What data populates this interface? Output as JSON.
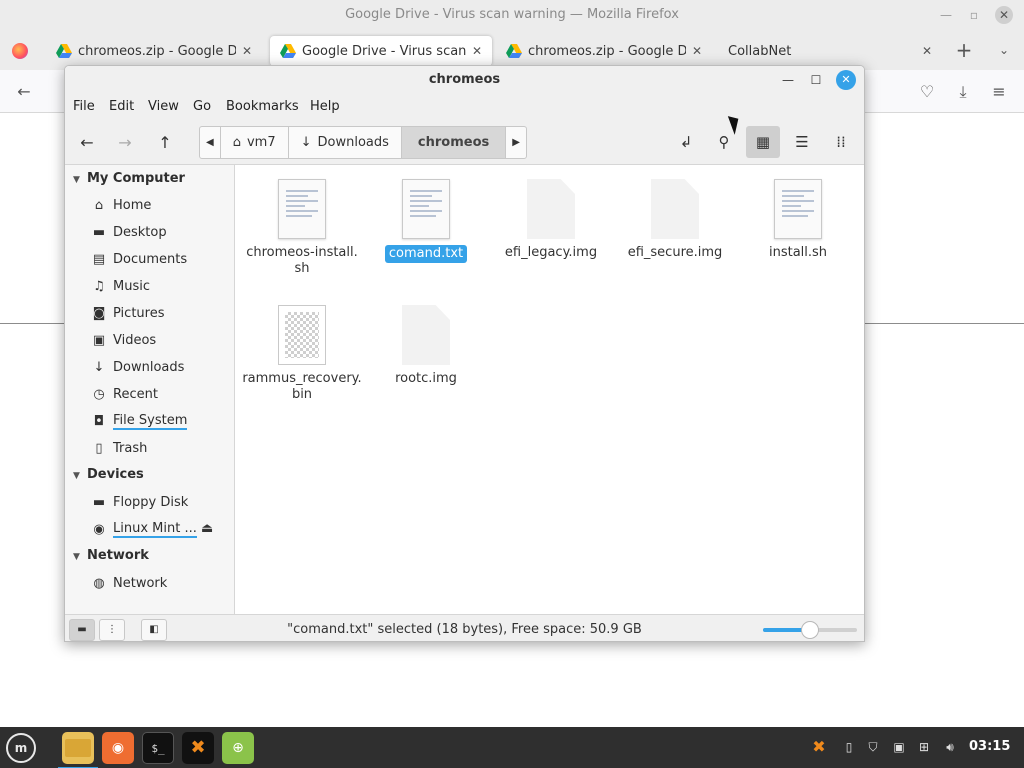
{
  "firefox": {
    "window_title": "Google Drive - Virus scan warning — Mozilla Firefox",
    "tabs": [
      {
        "label": "chromeos.zip - Google Drive",
        "active": false
      },
      {
        "label": "Google Drive - Virus scan wa",
        "active": true
      },
      {
        "label": "chromeos.zip - Google Drive",
        "active": false
      },
      {
        "label": "CollabNet",
        "active": false
      }
    ],
    "icons": [
      "firefox-icon",
      "google-drive-icon",
      "new-tab-icon",
      "list-all-tabs-icon",
      "back-icon",
      "pocket-icon",
      "downloads-icon",
      "hamburger-menu-icon"
    ]
  },
  "file_manager": {
    "title": "chromeos",
    "menu": [
      "File",
      "Edit",
      "View",
      "Go",
      "Bookmarks",
      "Help"
    ],
    "path": [
      {
        "label": "vm7",
        "icon": "home-icon"
      },
      {
        "label": "Downloads",
        "icon": "download-icon"
      },
      {
        "label": "chromeos",
        "icon": "",
        "current": true
      }
    ],
    "sidebar": {
      "my_computer": {
        "heading": "My Computer",
        "items": [
          {
            "label": "Home",
            "icon": "home-icon"
          },
          {
            "label": "Desktop",
            "icon": "desktop-icon"
          },
          {
            "label": "Documents",
            "icon": "documents-icon"
          },
          {
            "label": "Music",
            "icon": "music-icon"
          },
          {
            "label": "Pictures",
            "icon": "pictures-icon"
          },
          {
            "label": "Videos",
            "icon": "videos-icon"
          },
          {
            "label": "Downloads",
            "icon": "download-icon"
          },
          {
            "label": "Recent",
            "icon": "recent-icon"
          },
          {
            "label": "File System",
            "icon": "filesystem-icon"
          },
          {
            "label": "Trash",
            "icon": "trash-icon"
          }
        ]
      },
      "devices": {
        "heading": "Devices",
        "items": [
          {
            "label": "Floppy Disk",
            "icon": "floppy-icon"
          },
          {
            "label": "Linux Mint ...",
            "icon": "disc-icon"
          }
        ]
      },
      "network": {
        "heading": "Network",
        "items": [
          {
            "label": "Network",
            "icon": "network-icon"
          }
        ]
      }
    },
    "files": [
      {
        "name": "chromeos-install.\nsh",
        "kind": "text",
        "selected": false
      },
      {
        "name": "comand.txt",
        "kind": "text",
        "selected": true
      },
      {
        "name": "efi_legacy.img",
        "kind": "blank",
        "selected": false
      },
      {
        "name": "efi_secure.img",
        "kind": "blank",
        "selected": false
      },
      {
        "name": "install.sh",
        "kind": "text",
        "selected": false
      },
      {
        "name": "rammus_recovery.\nbin",
        "kind": "binary",
        "selected": false
      },
      {
        "name": "rootc.img",
        "kind": "blank",
        "selected": false
      }
    ],
    "status_text": "\"comand.txt\" selected (18 bytes), Free space: 50.9 GB",
    "zoom_level": 0.5,
    "accent_color": "#35a2e8"
  },
  "taskbar": {
    "clock": "03:15",
    "apps": [
      "files-icon",
      "firefox-icon",
      "terminal-icon",
      "xampp-icon",
      "network-globe-icon"
    ]
  }
}
